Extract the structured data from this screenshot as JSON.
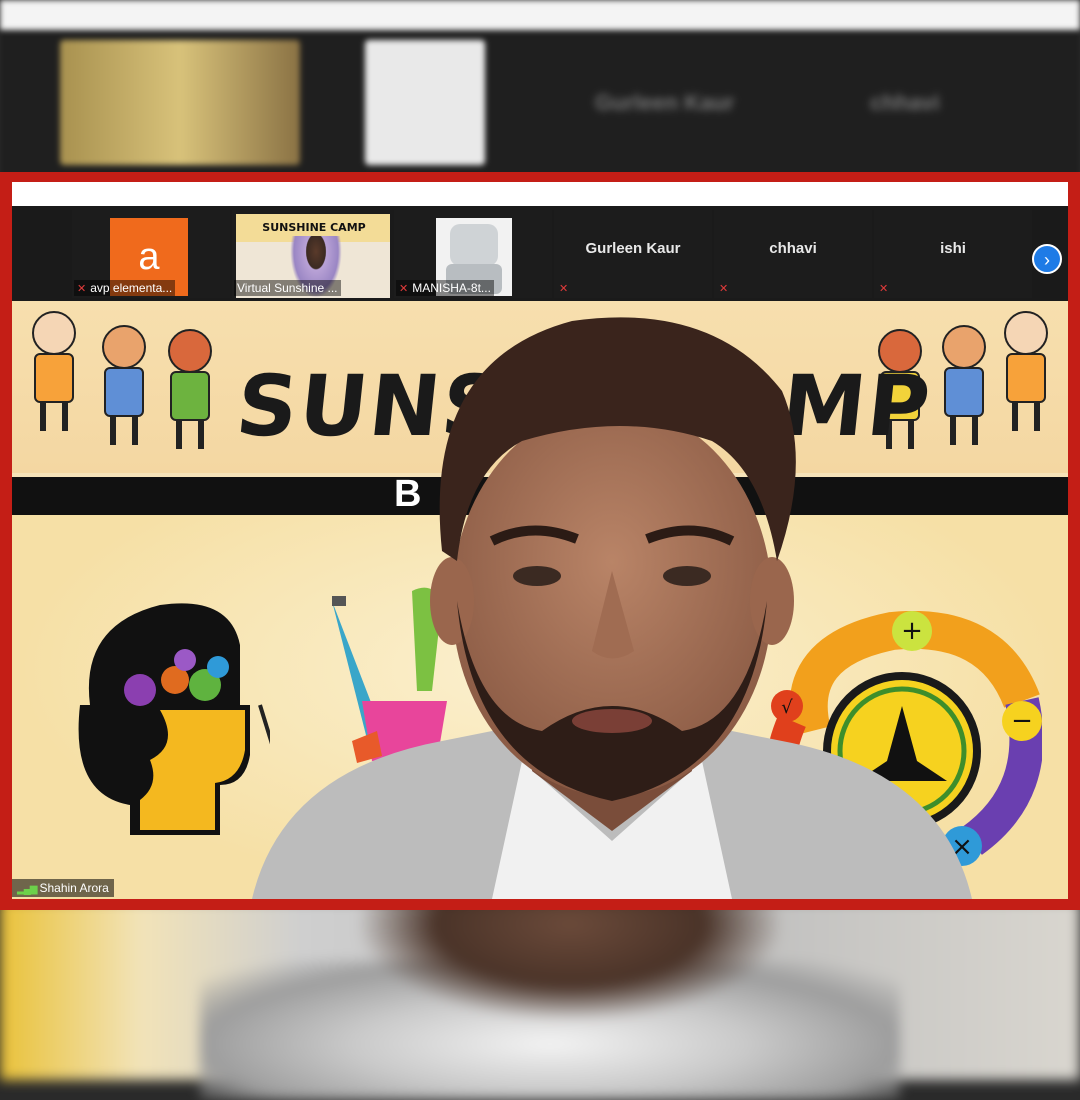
{
  "meeting": {
    "participants": [
      {
        "id": "avp",
        "label": "avp elementa...",
        "avatar_letter": "a",
        "avatar_color": "#f06a1c",
        "muted": true
      },
      {
        "id": "sunshine",
        "label": "Virtual Sunshine ...",
        "muted": false,
        "thumb_text": "SUNSHINE CAMP"
      },
      {
        "id": "manisha",
        "label": "MANISHA-8t...",
        "muted": true
      },
      {
        "id": "gurleen",
        "name": "Gurleen Kaur",
        "muted": true
      },
      {
        "id": "chhavi",
        "name": "chhavi",
        "muted": true
      },
      {
        "id": "ishi",
        "name": "ishi",
        "muted": true
      }
    ],
    "next_icon": "chevron-right-icon",
    "active_speaker": "Shahin Arora"
  },
  "background_ghost_names": [
    "Gurleen Kaur",
    "chhavi"
  ],
  "slide": {
    "title_left": "SUNS",
    "title_right": "MP",
    "strip_letter": "B"
  },
  "colors": {
    "frame_red": "#c41e16",
    "slide_bg": "#f6e3b9",
    "next_button_blue": "#1e7be6",
    "mute_red": "#e23b3b"
  }
}
